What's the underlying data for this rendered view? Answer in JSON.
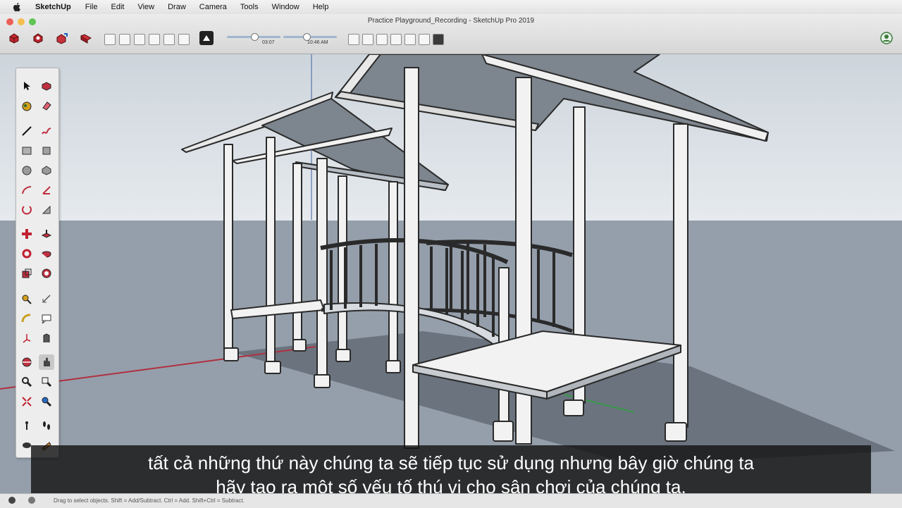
{
  "menubar": {
    "apple_icon": "apple-icon",
    "app_name": "SketchUp",
    "items": [
      "File",
      "Edit",
      "View",
      "Draw",
      "Camera",
      "Tools",
      "Window",
      "Help"
    ]
  },
  "window": {
    "title": "Practice Playground_Recording - SketchUp Pro 2019"
  },
  "toolbar": {
    "scene_time": "03:07",
    "scene_time_2": "10:46 AM"
  },
  "subtitle": {
    "line1": "tất cả những thứ này chúng ta sẽ tiếp tục sử dụng nhưng bây giờ chúng ta",
    "line2": "hãy tạo ra một số yếu tố thú vị cho sân chơi của chúng ta."
  },
  "statusbar": {
    "hint": "Drag to select objects. Shift = Add/Subtract. Ctrl = Add. Shift+Ctrl = Subtract."
  },
  "colors": {
    "sky": "#dde3e8",
    "ground": "#949fab",
    "structure": "#f2f2f2",
    "outline": "#2a2a2a",
    "axis_red": "#b03040",
    "axis_blue": "#4060a0"
  }
}
